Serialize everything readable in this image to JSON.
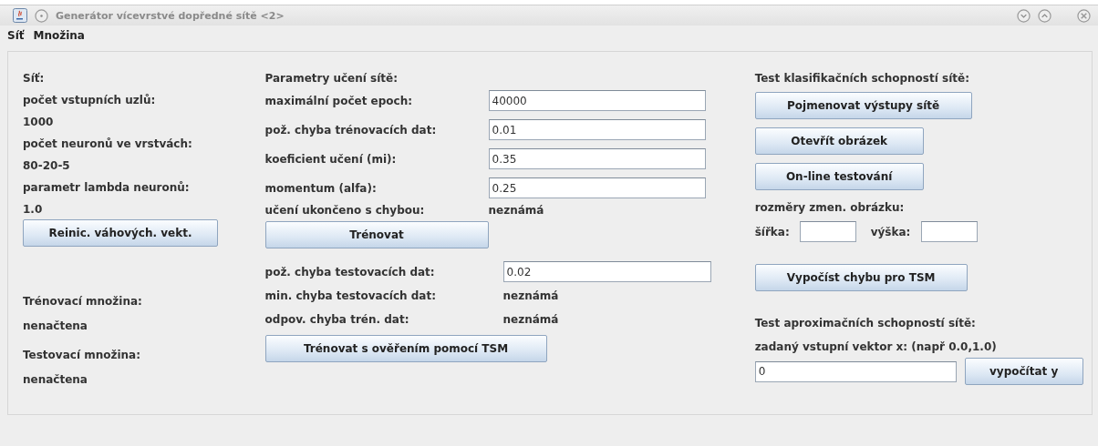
{
  "window": {
    "title": "Generátor vícevrstvé dopředné sítě <2>"
  },
  "menu": [
    {
      "label": "Síť"
    },
    {
      "label": "Množina"
    }
  ],
  "network": {
    "title": "Síť:",
    "fields": [
      {
        "label": "počet vstupních uzlů:",
        "value": "1000"
      },
      {
        "label": "počet neuronů ve vrstvách:",
        "value": "80-20-5"
      },
      {
        "label": "parametr lambda neuronů:",
        "value": "1.0"
      }
    ],
    "button": "Reinic. váhových. vekt.",
    "sets": [
      {
        "label": "Trénovací množina:",
        "value": "nenačtena"
      },
      {
        "label": "Testovací množina:",
        "value": "nenačtena"
      }
    ]
  },
  "training": {
    "title": "Parametry učení sítě:",
    "params": [
      {
        "label": "maximální počet epoch:",
        "value": "40000"
      },
      {
        "label": "pož. chyba trénovacích dat:",
        "value": "0.01"
      },
      {
        "label": "koeficient učení (mi):",
        "value": "0.35"
      },
      {
        "label": "momentum (alfa):",
        "value": "0.25"
      }
    ],
    "result": {
      "label": "učení ukončeno s chybou:",
      "value": "neznámá"
    },
    "train_button": "Trénovat",
    "test_error": {
      "label": "pož. chyba testovacích dat:",
      "value": "0.02"
    },
    "stats": [
      {
        "label": "min. chyba testovacích dat:",
        "value": "neznámá"
      },
      {
        "label": "odpov. chyba trén. dat:",
        "value": "neznámá"
      }
    ],
    "validate_button": "Trénovat s ověřením pomocí TSM"
  },
  "classification": {
    "title": "Test klasifikačních schopností sítě:",
    "buttons": [
      "Pojmenovat výstupy sítě",
      "Otevřít obrázek",
      "On-line testování"
    ],
    "size_label": "rozměry zmen. obrázku:",
    "width_label": "šířka:",
    "height_label": "výška:",
    "compute_button": "Vypočíst chybu pro TSM"
  },
  "approximation": {
    "title": "Test aproximačních schopností sítě:",
    "hint": "zadaný vstupní vektor x: (např 0.0,1.0)",
    "value": "0",
    "button": "vypočítat y"
  }
}
